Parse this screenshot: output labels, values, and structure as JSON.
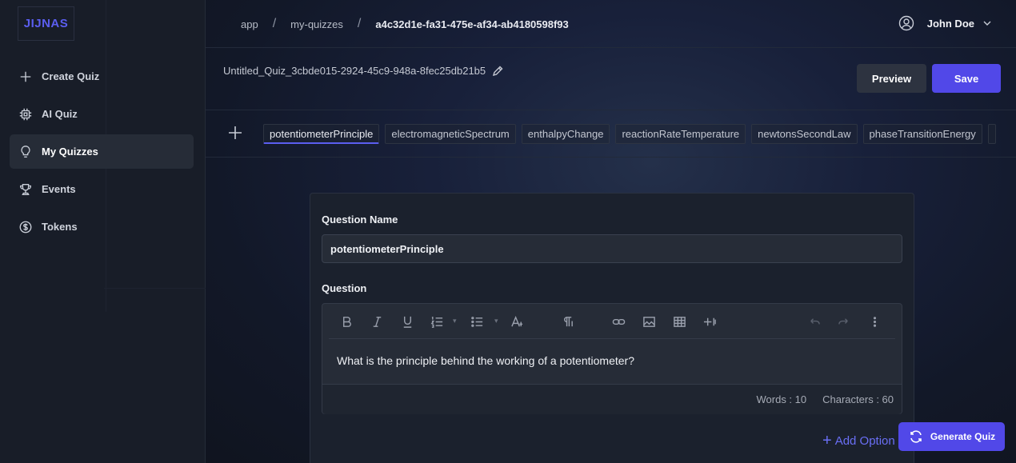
{
  "brand": {
    "logo_text": "JIJNAS",
    "accent": "#5b5ef0"
  },
  "sidebar": {
    "items": [
      {
        "label": "Create Quiz",
        "icon": "plus-icon"
      },
      {
        "label": "AI Quiz",
        "icon": "cpu-icon"
      },
      {
        "label": "My Quizzes",
        "icon": "lightbulb-icon",
        "active": true
      },
      {
        "label": "Events",
        "icon": "trophy-icon"
      },
      {
        "label": "Tokens",
        "icon": "dollar-coin-icon"
      }
    ]
  },
  "header": {
    "breadcrumbs": [
      "app",
      "my-quizzes",
      "a4c32d1e-fa31-475e-af34-ab4180598f93"
    ],
    "separator": "/",
    "user_name": "John Doe"
  },
  "quiz": {
    "title": "Untitled_Quiz_3cbde015-2924-45c9-948a-8fec25db21b5",
    "preview_label": "Preview",
    "save_label": "Save"
  },
  "tabs": [
    "potentiometerPrinciple",
    "electromagneticSpectrum",
    "enthalpyChange",
    "reactionRateTemperature",
    "newtonsSecondLaw",
    "phaseTransitionEnergy"
  ],
  "question": {
    "name_label": "Question Name",
    "name_value": "potentiometerPrinciple",
    "question_label": "Question",
    "text": "What is the principle behind the working of a potentiometer?",
    "words": "Words : 10",
    "characters": "Characters : 60"
  },
  "editor_toolbar": [
    "bold",
    "italic",
    "underline",
    "ordered-list",
    "bullet-list",
    "font-size",
    "paragraph",
    "link",
    "image",
    "table",
    "insert",
    "undo",
    "redo",
    "more"
  ],
  "add_option_label": "Add Option",
  "generate_quiz_label": "Generate Quiz"
}
